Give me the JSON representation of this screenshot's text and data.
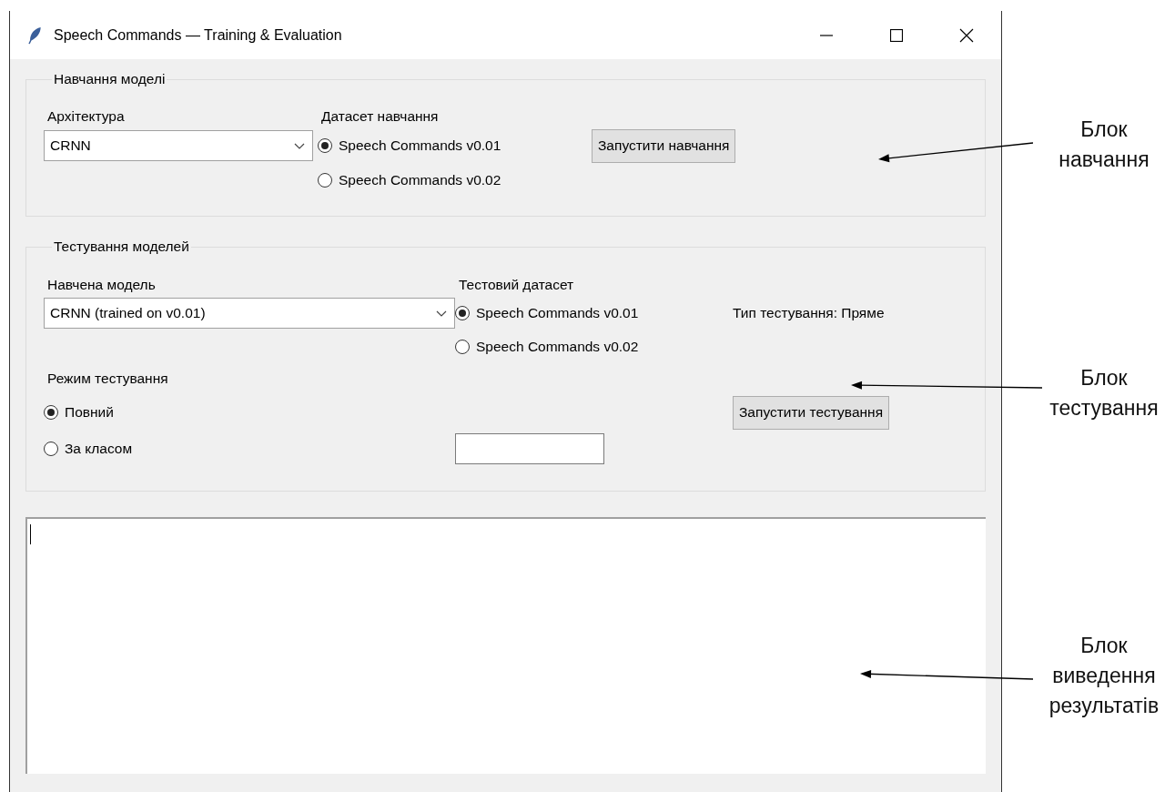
{
  "window": {
    "title": "Speech Commands — Training & Evaluation"
  },
  "training": {
    "legend": "Навчання моделі",
    "architecture": {
      "label": "Архітектура",
      "value": "CRNN"
    },
    "dataset": {
      "label": "Датасет навчання",
      "options": [
        {
          "label": "Speech Commands v0.01",
          "selected": true
        },
        {
          "label": "Speech Commands v0.02",
          "selected": false
        }
      ]
    },
    "button": "Запустити навчання"
  },
  "testing": {
    "legend": "Тестування моделей",
    "model": {
      "label": "Навчена модель",
      "value": "CRNN (trained on v0.01)"
    },
    "dataset": {
      "label": "Тестовий датасет",
      "options": [
        {
          "label": "Speech Commands v0.01",
          "selected": true
        },
        {
          "label": "Speech Commands v0.02",
          "selected": false
        }
      ]
    },
    "test_type": "Тип тестування: Пряме",
    "mode": {
      "label": "Режим тестування",
      "options": [
        {
          "label": "Повний",
          "selected": true
        },
        {
          "label": "За класом",
          "selected": false
        }
      ]
    },
    "button": "Запустити тестування"
  },
  "annotations": [
    {
      "lines": [
        "Блок",
        "навчання"
      ]
    },
    {
      "lines": [
        "Блок",
        "тестування"
      ]
    },
    {
      "lines": [
        "Блок",
        "виведення",
        "результатів"
      ]
    }
  ]
}
